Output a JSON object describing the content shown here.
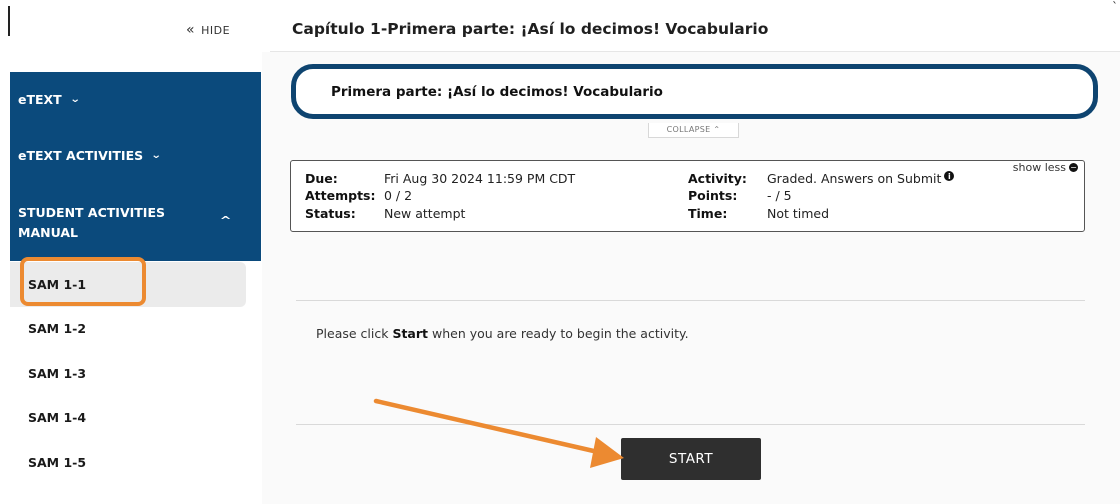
{
  "sidebar": {
    "hide_label": "HIDE",
    "hide_icon": "double-chevron-left-icon",
    "nav": [
      {
        "label": "eTEXT",
        "icon": "chevron-down-icon"
      },
      {
        "label": "eTEXT ACTIVITIES",
        "icon": "chevron-down-icon"
      }
    ],
    "section": {
      "label_line1": "STUDENT ACTIVITIES",
      "label_line2": "MANUAL",
      "icon": "chevron-up-icon"
    },
    "sam_items": [
      "SAM 1-1",
      "SAM 1-2",
      "SAM 1-3",
      "SAM 1-4",
      "SAM 1-5"
    ],
    "active_index": 0
  },
  "header": {
    "title": "Capítulo 1-Primera parte: ¡Así lo decimos! Vocabulario"
  },
  "banner": {
    "title": "Primera parte: ¡Así lo decimos! Vocabulario",
    "collapse_label": "COLLAPSE"
  },
  "info": {
    "show_less": "show less",
    "due_label": "Due:",
    "due_value": "Fri Aug 30 2024 11:59 PM CDT",
    "attempts_label": "Attempts:",
    "attempts_value": "0 / 2",
    "status_label": "Status:",
    "status_value": "New attempt",
    "activity_label": "Activity:",
    "activity_value": "Graded. Answers on Submit",
    "points_label": "Points:",
    "points_value": "- / 5",
    "time_label": "Time:",
    "time_value": "Not timed"
  },
  "content": {
    "instruction_before": "Please click ",
    "instruction_bold": "Start",
    "instruction_after": " when you are ready to begin the activity.",
    "start_button": "START"
  },
  "colors": {
    "nav_blue": "#0b4a7c",
    "banner_border": "#0e4470",
    "highlight_orange": "#ec8a31",
    "start_button": "#2f2f2f"
  }
}
